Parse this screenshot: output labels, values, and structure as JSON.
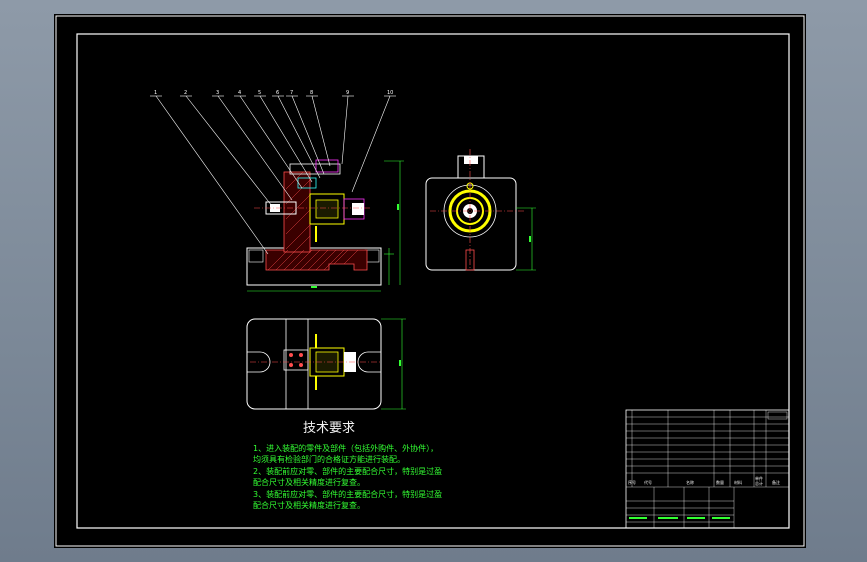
{
  "drawing": {
    "balloon_numbers": [
      "1",
      "2",
      "3",
      "4",
      "5",
      "6",
      "7",
      "8",
      "9",
      "10"
    ],
    "tech_requirements": {
      "title": "技术要求",
      "lines": [
        "1、进入装配的零件及部件（包括外购件、外协件），",
        "均须具有检验部门的合格证方能进行装配。",
        "2、装配前应对零、部件的主要配合尺寸，特别是过盈",
        "配合尺寸及相关精度进行复查。",
        "3、装配前应对零、部件的主要配合尺寸，特别是过盈",
        "配合尺寸及相关精度进行复查。"
      ]
    },
    "title_block": {
      "header": [
        "序号",
        "代号",
        "名称",
        "数量",
        "材料",
        "单件",
        "总计",
        "备注"
      ]
    }
  },
  "colors": {
    "background": "#000000",
    "frame": "#ffffff",
    "part_lines": "#ffffff",
    "dimension": "#33ff33",
    "hatch": "#ff4d4d",
    "accent_yellow": "#ffff00",
    "accent_magenta": "#ff33ff",
    "accent_cyan": "#33ffff",
    "text_green": "#33ff33"
  }
}
